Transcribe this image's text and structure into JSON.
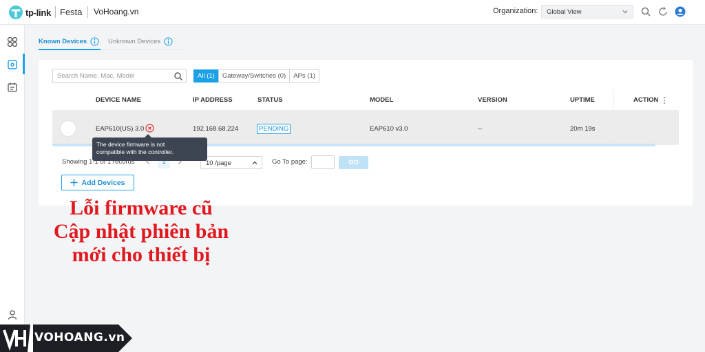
{
  "header": {
    "logo_text": "tp-link",
    "brand": "Festa",
    "site": "VoHoang.vn",
    "org_label": "Organization:",
    "org_value": "Global View"
  },
  "tabs": [
    {
      "label": "Known Devices",
      "active": true
    },
    {
      "label": "Unknown Devices",
      "active": false
    }
  ],
  "search": {
    "placeholder": "Search Name, Mac, Model"
  },
  "filters": [
    {
      "label": "All (1)",
      "active": true
    },
    {
      "label": "Gateway/Switches (0)",
      "active": false
    },
    {
      "label": "APs (1)",
      "active": false
    }
  ],
  "table": {
    "columns": [
      "DEVICE NAME",
      "IP ADDRESS",
      "STATUS",
      "MODEL",
      "VERSION",
      "UPTIME",
      "ACTION"
    ],
    "rows": [
      {
        "device_name": "EAP610(US) 3.0",
        "ip": "192.168.68.224",
        "status": "PENDING",
        "model": "EAP610 v3.0",
        "version": "--",
        "uptime": "20m 19s"
      }
    ]
  },
  "tooltip": {
    "line1": "The device firmware is not",
    "line2": "compatible with the controller."
  },
  "pagination": {
    "showing": "Showing 1-1 of 1 records",
    "current_page": "1",
    "per_page": "10 /page",
    "goto_label": "Go To page:",
    "go_label": "GO"
  },
  "add_button": "Add Devices",
  "caption": {
    "line1": "Lỗi firmware cũ",
    "line2": "Cập nhật phiên bản",
    "line3": "mới cho thiết bị"
  },
  "watermark": "VOHOANG.vn",
  "colors": {
    "accent": "#1aa0e6",
    "error": "#e0191f",
    "tooltip_bg": "#3d4552"
  }
}
